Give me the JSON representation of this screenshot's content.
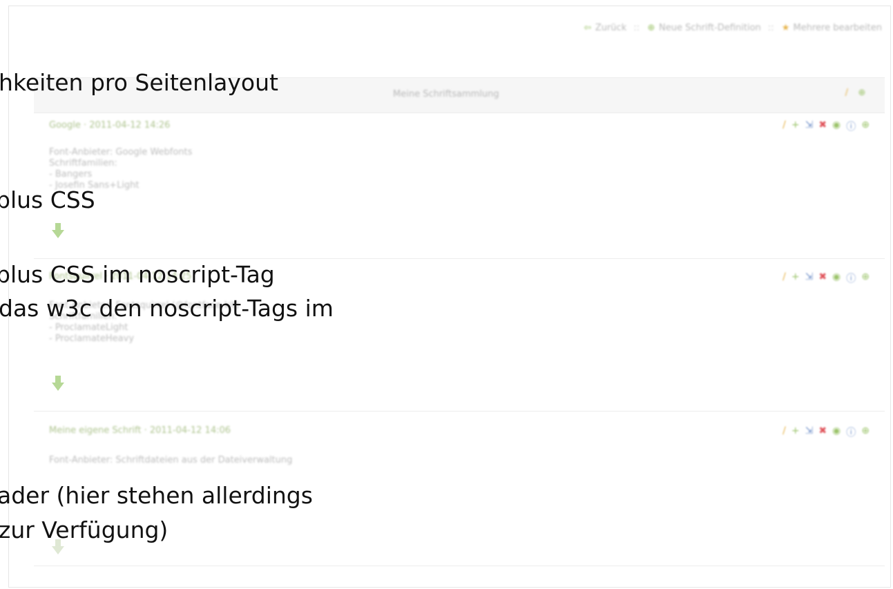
{
  "nav": {
    "back": "Zurück",
    "new_def": "Neue Schrift-Definition",
    "edit_multi": "Mehrere bearbeiten",
    "sep": "::"
  },
  "header": {
    "title": "Meine Schriftsammlung"
  },
  "entries": [
    {
      "title": "Google · 2011-04-12 14:26",
      "lines": [
        "Font-Anbieter: Google Webfonts",
        "Schriftfamilien:",
        "- Bangers",
        "- Josefin Sans+Light"
      ]
    },
    {
      "title": "Fontsquirrel · 2011-04-12 14:25",
      "lines": [
        "Font-Anbieter: Fontsquirrel (@fontface-kit)",
        "Schriftfamilien:",
        "- ProclamateLight",
        "- ProclamateHeavy"
      ]
    },
    {
      "title": "Meine eigene Schrift · 2011-04-12 14:06",
      "lines": [
        "Font-Anbieter: Schriftdateien aus der Dateiverwaltung"
      ]
    }
  ],
  "overlay_lines": [
    "hkeiten pro Seitenlayout",
    "plus CSS",
    "plus CSS im noscript-Tag",
    "das w3c den noscript-Tags im",
    "ader (hier stehen allerdings",
    "zur Verfügung)"
  ],
  "colors": {
    "green": "#9cc46b",
    "red": "#e0555c",
    "blue": "#6f8fc8",
    "orange": "#e6b34a"
  }
}
